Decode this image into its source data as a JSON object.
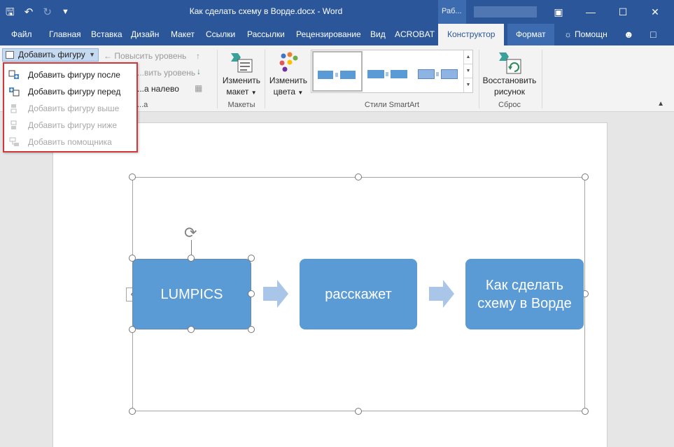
{
  "titlebar": {
    "title": "Как сделать схему в Ворде.docx - Word",
    "context_tag": "Раб...",
    "save_icon": "save-icon",
    "undo_icon": "undo-icon",
    "redo_icon": "redo-icon"
  },
  "tabs": {
    "items": [
      "Файл",
      "Главная",
      "Вставка",
      "Дизайн",
      "Макет",
      "Ссылки",
      "Рассылки",
      "Рецензирование",
      "Вид",
      "ACROBAT"
    ],
    "active": "Конструктор",
    "format": "Формат",
    "help": "Помощн"
  },
  "ribbon": {
    "add_shape": "Добавить фигуру",
    "promote": "Повысить уровень",
    "demote": "...вить уровень",
    "right_to_left": "...а налево",
    "pane_group_label": "...а",
    "change_layout": [
      "Изменить",
      "макет"
    ],
    "layouts_group": "Макеты",
    "change_colors": [
      "Изменить",
      "цвета"
    ],
    "styles_group": "Стили SmartArt",
    "reset_graphic": [
      "Восстановить",
      "рисунок"
    ],
    "reset_group": "Сброс"
  },
  "dropdown": {
    "items": [
      {
        "label": "Добавить фигуру после",
        "enabled": true
      },
      {
        "label": "Добавить фигуру перед",
        "enabled": true
      },
      {
        "label": "Добавить фигуру выше",
        "enabled": false
      },
      {
        "label": "Добавить фигуру ниже",
        "enabled": false
      },
      {
        "label": "Добавить помощника",
        "enabled": false
      }
    ]
  },
  "smartart": {
    "nodes": [
      "LUMPICS",
      "расскажет",
      "Как сделать схему в Ворде"
    ],
    "node_color": "#5b9bd5",
    "arrow_color": "#a9c6e8"
  },
  "colors": {
    "accent": "#2b579a",
    "highlight_border": "#d2373a"
  }
}
